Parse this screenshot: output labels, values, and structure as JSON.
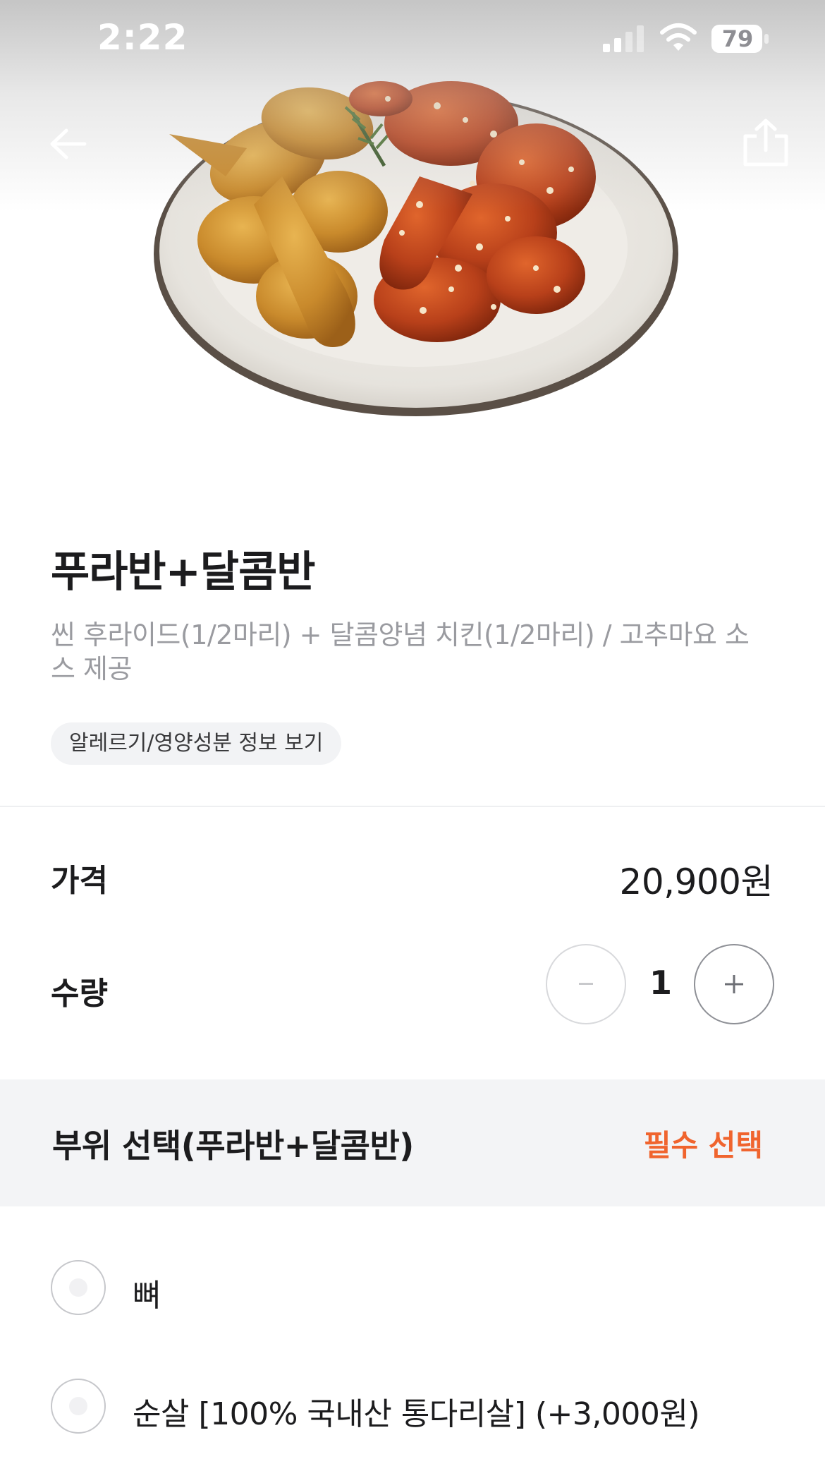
{
  "status_bar": {
    "time": "2:22",
    "battery": "79"
  },
  "product": {
    "title": "푸라반+달콤반",
    "description": "씬 후라이드(1/2마리) + 달콤양념 치킨(1/2마리) / 고추마요 소스 제공",
    "allergy_chip": "알레르기/영양성분 정보 보기"
  },
  "price": {
    "label": "가격",
    "value": "20,900원"
  },
  "quantity": {
    "label": "수량",
    "value": "1",
    "minus_symbol": "−",
    "plus_symbol": "+"
  },
  "option_group": {
    "title": "부위 선택(푸라반+달콤반)",
    "required_label": "필수 선택",
    "options": [
      {
        "label": "뼈"
      },
      {
        "label": "순살 [100% 국내산 통다리살] (+3,000원)"
      }
    ]
  },
  "colors": {
    "accent_required": "#f0642e",
    "divider": "#eeeff1",
    "section_bg": "#f3f4f6"
  },
  "icons": {
    "back": "arrow-left-icon",
    "share": "share-icon",
    "signal": "cellular-signal-icon",
    "wifi": "wifi-icon",
    "battery": "battery-icon"
  }
}
